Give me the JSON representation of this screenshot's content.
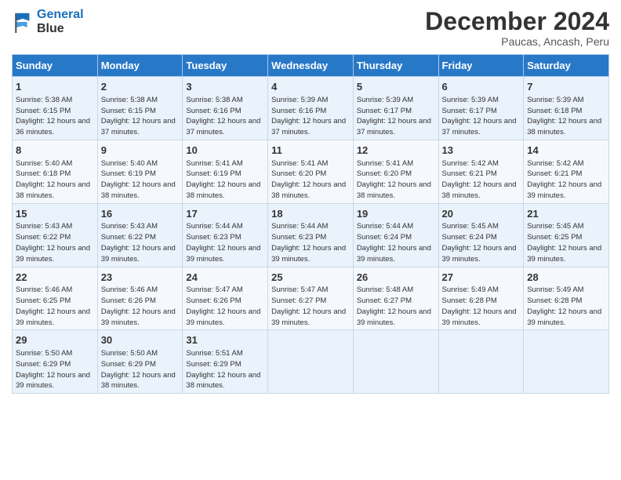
{
  "logo": {
    "line1": "General",
    "line2": "Blue"
  },
  "title": "December 2024",
  "location": "Paucas, Ancash, Peru",
  "days_of_week": [
    "Sunday",
    "Monday",
    "Tuesday",
    "Wednesday",
    "Thursday",
    "Friday",
    "Saturday"
  ],
  "weeks": [
    [
      {
        "num": "1",
        "rise": "5:38 AM",
        "set": "6:15 PM",
        "daylight": "12 hours and 36 minutes."
      },
      {
        "num": "2",
        "rise": "5:38 AM",
        "set": "6:15 PM",
        "daylight": "12 hours and 37 minutes."
      },
      {
        "num": "3",
        "rise": "5:38 AM",
        "set": "6:16 PM",
        "daylight": "12 hours and 37 minutes."
      },
      {
        "num": "4",
        "rise": "5:39 AM",
        "set": "6:16 PM",
        "daylight": "12 hours and 37 minutes."
      },
      {
        "num": "5",
        "rise": "5:39 AM",
        "set": "6:17 PM",
        "daylight": "12 hours and 37 minutes."
      },
      {
        "num": "6",
        "rise": "5:39 AM",
        "set": "6:17 PM",
        "daylight": "12 hours and 37 minutes."
      },
      {
        "num": "7",
        "rise": "5:39 AM",
        "set": "6:18 PM",
        "daylight": "12 hours and 38 minutes."
      }
    ],
    [
      {
        "num": "8",
        "rise": "5:40 AM",
        "set": "6:18 PM",
        "daylight": "12 hours and 38 minutes."
      },
      {
        "num": "9",
        "rise": "5:40 AM",
        "set": "6:19 PM",
        "daylight": "12 hours and 38 minutes."
      },
      {
        "num": "10",
        "rise": "5:41 AM",
        "set": "6:19 PM",
        "daylight": "12 hours and 38 minutes."
      },
      {
        "num": "11",
        "rise": "5:41 AM",
        "set": "6:20 PM",
        "daylight": "12 hours and 38 minutes."
      },
      {
        "num": "12",
        "rise": "5:41 AM",
        "set": "6:20 PM",
        "daylight": "12 hours and 38 minutes."
      },
      {
        "num": "13",
        "rise": "5:42 AM",
        "set": "6:21 PM",
        "daylight": "12 hours and 38 minutes."
      },
      {
        "num": "14",
        "rise": "5:42 AM",
        "set": "6:21 PM",
        "daylight": "12 hours and 39 minutes."
      }
    ],
    [
      {
        "num": "15",
        "rise": "5:43 AM",
        "set": "6:22 PM",
        "daylight": "12 hours and 39 minutes."
      },
      {
        "num": "16",
        "rise": "5:43 AM",
        "set": "6:22 PM",
        "daylight": "12 hours and 39 minutes."
      },
      {
        "num": "17",
        "rise": "5:44 AM",
        "set": "6:23 PM",
        "daylight": "12 hours and 39 minutes."
      },
      {
        "num": "18",
        "rise": "5:44 AM",
        "set": "6:23 PM",
        "daylight": "12 hours and 39 minutes."
      },
      {
        "num": "19",
        "rise": "5:44 AM",
        "set": "6:24 PM",
        "daylight": "12 hours and 39 minutes."
      },
      {
        "num": "20",
        "rise": "5:45 AM",
        "set": "6:24 PM",
        "daylight": "12 hours and 39 minutes."
      },
      {
        "num": "21",
        "rise": "5:45 AM",
        "set": "6:25 PM",
        "daylight": "12 hours and 39 minutes."
      }
    ],
    [
      {
        "num": "22",
        "rise": "5:46 AM",
        "set": "6:25 PM",
        "daylight": "12 hours and 39 minutes."
      },
      {
        "num": "23",
        "rise": "5:46 AM",
        "set": "6:26 PM",
        "daylight": "12 hours and 39 minutes."
      },
      {
        "num": "24",
        "rise": "5:47 AM",
        "set": "6:26 PM",
        "daylight": "12 hours and 39 minutes."
      },
      {
        "num": "25",
        "rise": "5:47 AM",
        "set": "6:27 PM",
        "daylight": "12 hours and 39 minutes."
      },
      {
        "num": "26",
        "rise": "5:48 AM",
        "set": "6:27 PM",
        "daylight": "12 hours and 39 minutes."
      },
      {
        "num": "27",
        "rise": "5:49 AM",
        "set": "6:28 PM",
        "daylight": "12 hours and 39 minutes."
      },
      {
        "num": "28",
        "rise": "5:49 AM",
        "set": "6:28 PM",
        "daylight": "12 hours and 39 minutes."
      }
    ],
    [
      {
        "num": "29",
        "rise": "5:50 AM",
        "set": "6:29 PM",
        "daylight": "12 hours and 39 minutes."
      },
      {
        "num": "30",
        "rise": "5:50 AM",
        "set": "6:29 PM",
        "daylight": "12 hours and 38 minutes."
      },
      {
        "num": "31",
        "rise": "5:51 AM",
        "set": "6:29 PM",
        "daylight": "12 hours and 38 minutes."
      },
      null,
      null,
      null,
      null
    ]
  ]
}
